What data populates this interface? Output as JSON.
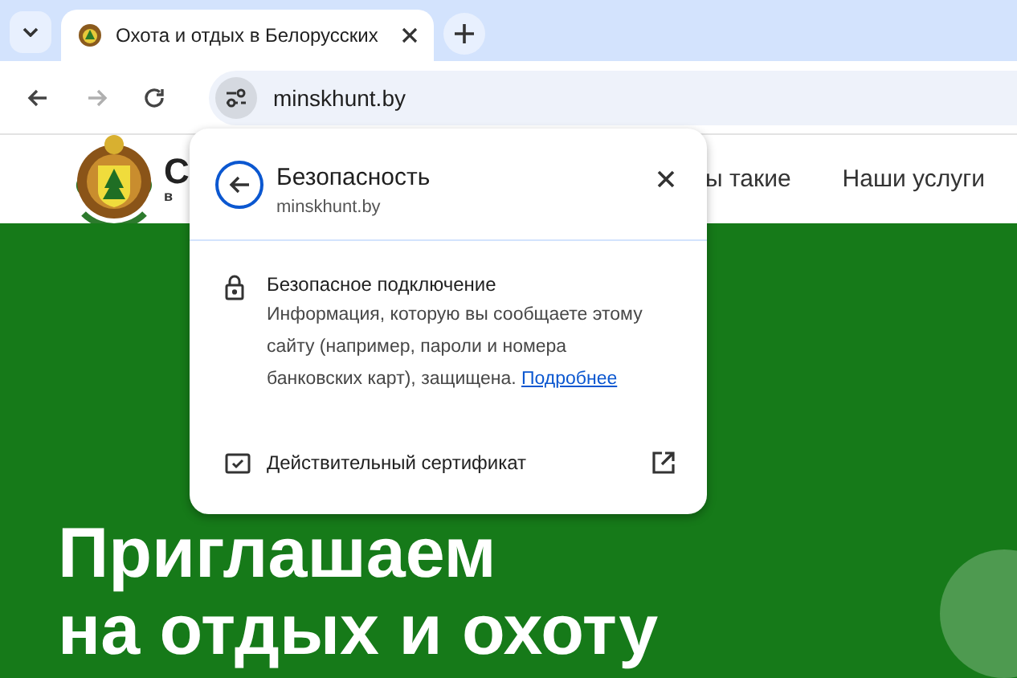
{
  "tab_strip": {
    "tabs": [
      {
        "title": "Охота и отдых в Белорусских",
        "selected": true
      }
    ]
  },
  "toolbar": {
    "nav_buttons": [
      {
        "kind": "back",
        "disabled": false
      },
      {
        "kind": "forward",
        "disabled": true
      },
      {
        "kind": "reload",
        "disabled": false
      }
    ],
    "url": "minskhunt.by"
  },
  "page": {
    "header": {
      "logo_text": "С",
      "logo_subtext": "в",
      "nav": [
        "ы такие",
        "Наши услуги"
      ]
    },
    "hero": {
      "lines": [
        "Приглашаем",
        "на отдых и охоту"
      ]
    }
  },
  "security_popup": {
    "title": "Безопасность",
    "domain": "minskhunt.by",
    "connection": {
      "title": "Безопасное подключение",
      "text": "Информация, которую вы сообщаете этому сайту (например, пароли и номера банковских карт), защищена.",
      "link": "Подробнее"
    },
    "certificate": {
      "label": "Действительный сертификат"
    }
  }
}
